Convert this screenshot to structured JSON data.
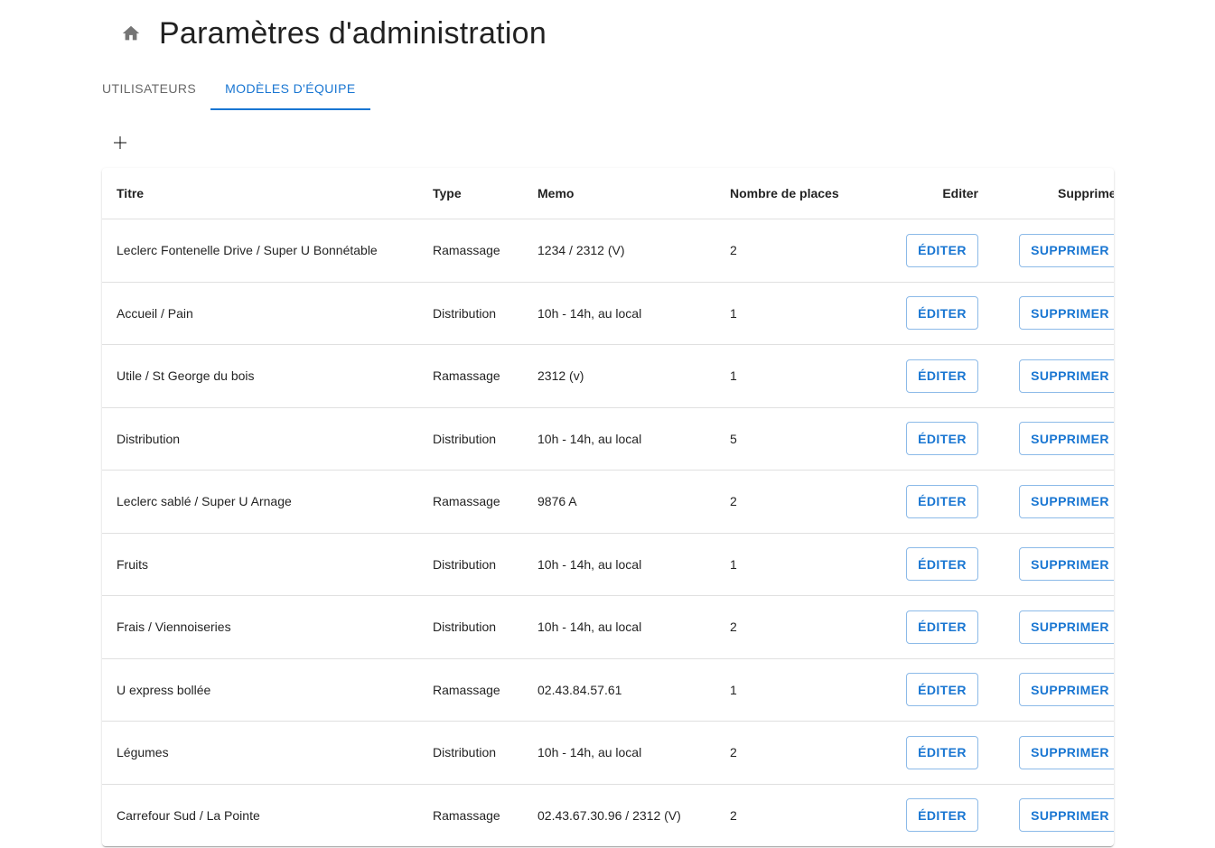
{
  "header": {
    "title": "Paramètres d'administration",
    "home_icon": "home-icon"
  },
  "tabs": [
    {
      "label": "UTILISATEURS",
      "active": false
    },
    {
      "label": "MODÈLES D'ÉQUIPE",
      "active": true
    }
  ],
  "toolbar": {
    "add_icon": "plus-icon"
  },
  "colors": {
    "accent": "#1976d2",
    "text": "#212121",
    "muted": "#757575"
  },
  "table": {
    "headers": {
      "titre": "Titre",
      "type": "Type",
      "memo": "Memo",
      "places": "Nombre de places",
      "editer": "Editer",
      "supprimer": "Supprimer"
    },
    "edit_label": "ÉDITER",
    "delete_label": "SUPPRIMER",
    "rows": [
      {
        "titre": "Leclerc Fontenelle Drive / Super U Bonnétable",
        "type": "Ramassage",
        "memo": "1234 / 2312 (V)",
        "places": "2"
      },
      {
        "titre": "Accueil / Pain",
        "type": "Distribution",
        "memo": "10h - 14h, au local",
        "places": "1"
      },
      {
        "titre": "Utile / St George du bois",
        "type": "Ramassage",
        "memo": "2312 (v)",
        "places": "1"
      },
      {
        "titre": "Distribution",
        "type": "Distribution",
        "memo": "10h - 14h, au local",
        "places": "5"
      },
      {
        "titre": "Leclerc sablé / Super U Arnage",
        "type": "Ramassage",
        "memo": "9876 A",
        "places": "2"
      },
      {
        "titre": "Fruits",
        "type": "Distribution",
        "memo": "10h - 14h, au local",
        "places": "1"
      },
      {
        "titre": "Frais / Viennoiseries",
        "type": "Distribution",
        "memo": "10h - 14h, au local",
        "places": "2"
      },
      {
        "titre": "U express bollée",
        "type": "Ramassage",
        "memo": "02.43.84.57.61",
        "places": "1"
      },
      {
        "titre": "Légumes",
        "type": "Distribution",
        "memo": "10h - 14h, au local",
        "places": "2"
      },
      {
        "titre": "Carrefour Sud / La Pointe",
        "type": "Ramassage",
        "memo": "02.43.67.30.96 / 2312 (V)",
        "places": "2"
      }
    ]
  }
}
